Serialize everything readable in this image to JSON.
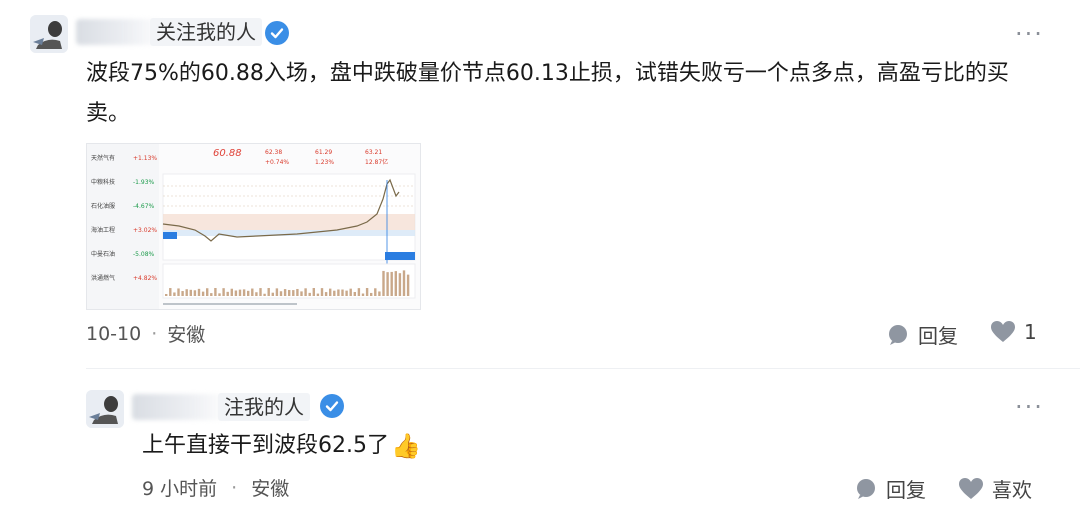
{
  "posts": [
    {
      "author": "关注我的人",
      "text": "波段75%的60.88入场，盘中跌破量价节点60.13止损，试错失败亏一个点多点，高盈亏比的买卖。",
      "date": "10-10",
      "separator": "·",
      "location": "安徽",
      "reply_label": "回复",
      "like_count": "1"
    },
    {
      "author": "注我的人",
      "text": "上午直接干到波段62.5了",
      "emoji": "👍",
      "date": "9 小时前",
      "location": "安徽",
      "reply_label": "回复",
      "like_label": "喜欢"
    }
  ],
  "thumbnail": {
    "stock_items": [
      {
        "label": "天然气有",
        "change": "+1.13%"
      },
      {
        "label": "中粮科技",
        "change": "-1.93%"
      },
      {
        "label": "石化油服",
        "change": "-4.67%"
      },
      {
        "label": "海油工程",
        "change": "+3.02%"
      },
      {
        "label": "中曼石油",
        "change": "-5.08%"
      },
      {
        "label": "洪通燃气",
        "change": "+4.82%"
      }
    ],
    "header_values": [
      "62.38",
      "61.29",
      "63.21",
      "+0.74%",
      "1.23%",
      "12.87亿"
    ],
    "handwritten_note": "60.88",
    "chart_type": "line",
    "accent_colors": {
      "price_line": "#7a6a4a",
      "band_fill": "#f3dccf",
      "volume": "#c9a88a",
      "blue_marker": "#2a7de1"
    }
  },
  "colors": {
    "verified": "#3a8ee6",
    "icon_gray": "#8f96a1",
    "text": "#1a1a1a",
    "meta": "#555555"
  }
}
